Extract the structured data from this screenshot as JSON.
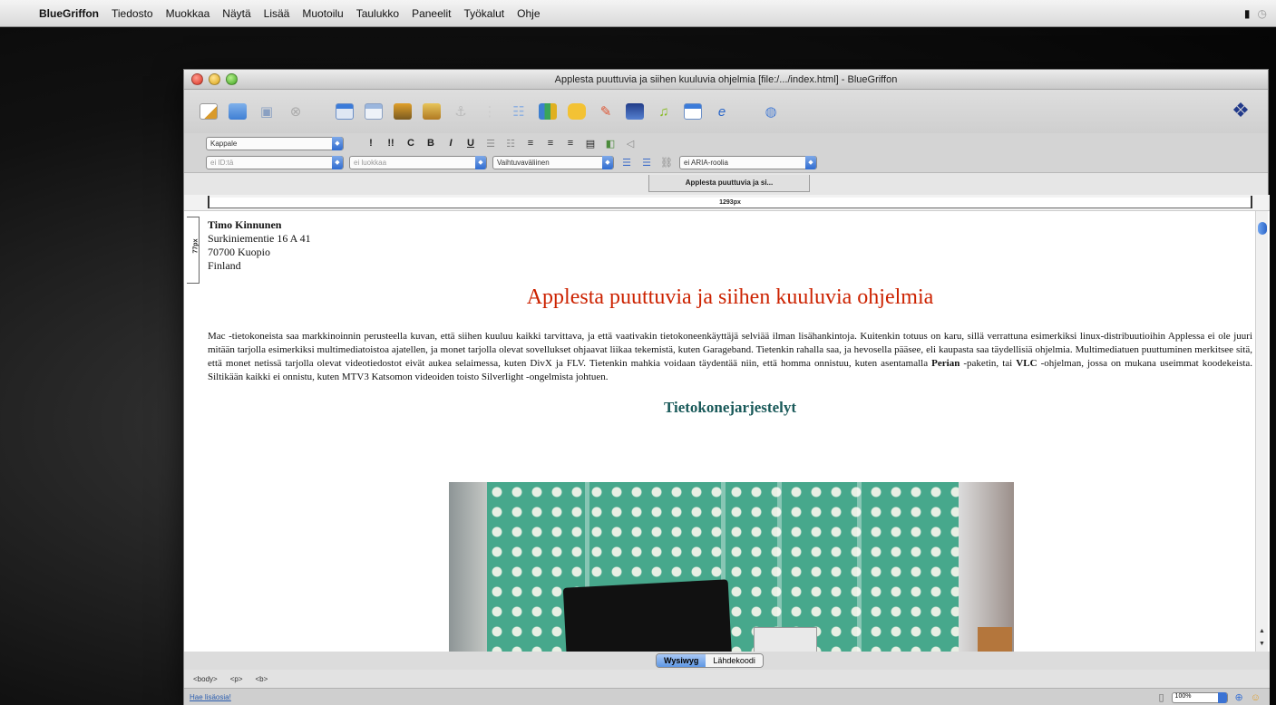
{
  "menubar": {
    "app": "BlueGriffon",
    "items": [
      "Tiedosto",
      "Muokkaa",
      "Näytä",
      "Lisää",
      "Muotoilu",
      "Taulukko",
      "Paneelit",
      "Työkalut",
      "Ohje"
    ]
  },
  "window": {
    "title": "Applesta puuttuvia ja siihen kuuluvia ohjelmia [file:/.../index.html] - BlueGriffon"
  },
  "format_bar": {
    "paragraph_style": "Kappale",
    "buttons": [
      "!",
      "!!",
      "C",
      "B",
      "I",
      "U"
    ]
  },
  "attr_bar": {
    "id_placeholder": "ei ID:tä",
    "class_placeholder": "ei luokkaa",
    "width_mode": "Vaihtuvaväliinen",
    "aria_placeholder": "ei ARIA-roolia",
    "tooltip": "Applesta puuttuvia ja si..."
  },
  "rulers": {
    "horizontal": "1293px",
    "vertical": "77px"
  },
  "document": {
    "address": {
      "name": "Timo Kinnunen",
      "street": "Surkiniementie 16 A 41",
      "city": "70700 Kuopio",
      "country": "Finland"
    },
    "heading": "Applesta puuttuvia ja siihen kuuluvia ohjelmia",
    "paragraph_1": "Mac -tietokoneista saa markkinoinnin perusteella kuvan, että siihen kuuluu kaikki tarvittava, ja että vaativakin tietokoneenkäyttäjä selviää ilman lisähankintoja. Kuitenkin totuus on karu, sillä verrattuna esimerkiksi linux-distribuutioihin Applessa ei ole juuri mitään tarjolla esimerkiksi multimediatoistoa ajatellen, ja monet tarjolla olevat sovellukset ohjaavat liikaa tekemistä, kuten Garageband. Tietenkin rahalla saa, ja hevosella pääsee, eli kaupasta saa täydellisiä ohjelmia. Multimediatuen puuttuminen merkitsee sitä, että monet netissä tarjolla olevat videotiedostot eivät aukea selaimessa, kuten DivX ja FLV. Tietenkin mahkia voidaan täydentää niin, että homma onnistuu, kuten asentamalla",
    "perian": "Perian",
    "paragraph_2": "-paketin, tai",
    "vlc": "VLC",
    "paragraph_3": "-ohjelman, jossa on mukana useimmat koodekeista. Siltikään kaikki ei onnistu, kuten MTV3 Katsomon videoiden toisto Silverlight -ongelmista johtuen.",
    "subheading": "Tietokonejarjestelyt"
  },
  "modes": {
    "wysiwyg": "Wysiwyg",
    "source": "Lähdekoodi"
  },
  "breadcrumbs": [
    "<body>",
    "<p>",
    "<b>"
  ],
  "status": {
    "link": "Hae lisäosia!",
    "zoom": "100%"
  }
}
